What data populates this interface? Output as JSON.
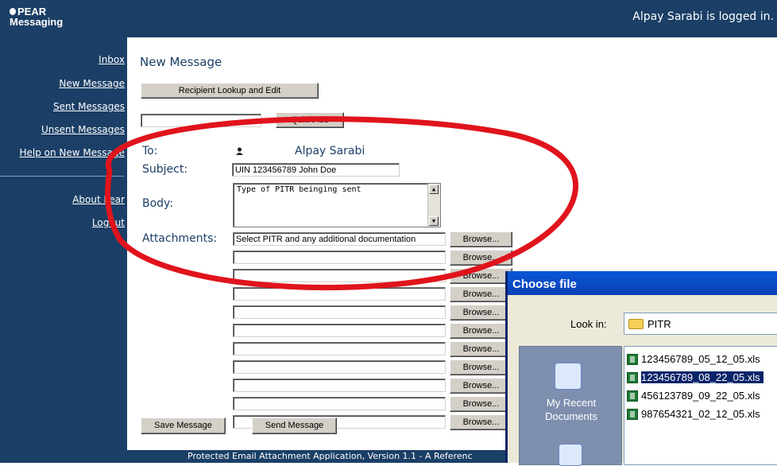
{
  "app": {
    "logo_line1": "PEAR",
    "logo_line2": "Messaging",
    "logged_in": "Alpay Sarabi is logged in."
  },
  "sidebar": {
    "items": [
      {
        "label": "Inbox"
      },
      {
        "label": "New Message"
      },
      {
        "label": "Sent Messages"
      },
      {
        "label": "Unsent Messages"
      },
      {
        "label": "Help on New Message"
      },
      {
        "label": "About Pear"
      },
      {
        "label": "Logout"
      }
    ]
  },
  "page": {
    "title": "New Message"
  },
  "form": {
    "recipient_lookup": "Recipient Lookup and Edit",
    "quickadd_value": "",
    "quickadd": "QuickAdd",
    "to_label": "To:",
    "to_name": "Alpay Sarabi",
    "subject_label": "Subject:",
    "subject_value": "UIN 123456789 John Doe",
    "body_label": "Body:",
    "body_value": "Type of PITR beinging sent",
    "attachments_label": "Attachments:",
    "attachments": [
      "Select PITR and any additional documentation",
      "",
      "",
      "",
      "",
      "",
      "",
      "",
      "",
      "",
      ""
    ],
    "browse": "Browse...",
    "save": "Save Message",
    "send": "Send Message"
  },
  "footer": {
    "text": "Protected Email Attachment Application, Version 1.1 - A Referenc"
  },
  "dialog": {
    "title": "Choose file",
    "look_in_label": "Look in:",
    "look_in_value": "PITR",
    "places": [
      {
        "label": "My Recent Documents"
      }
    ],
    "files": [
      {
        "name": "123456789_05_12_05.xls",
        "selected": false
      },
      {
        "name": "123456789_08_22_05.xls",
        "selected": true
      },
      {
        "name": "456123789_09_22_05.xls",
        "selected": false
      },
      {
        "name": "987654321_02_12_05.xls",
        "selected": false
      }
    ]
  },
  "colors": {
    "nav_bg": "#1b3f66",
    "annotation": "#e0141c",
    "selection": "#0a246a"
  }
}
